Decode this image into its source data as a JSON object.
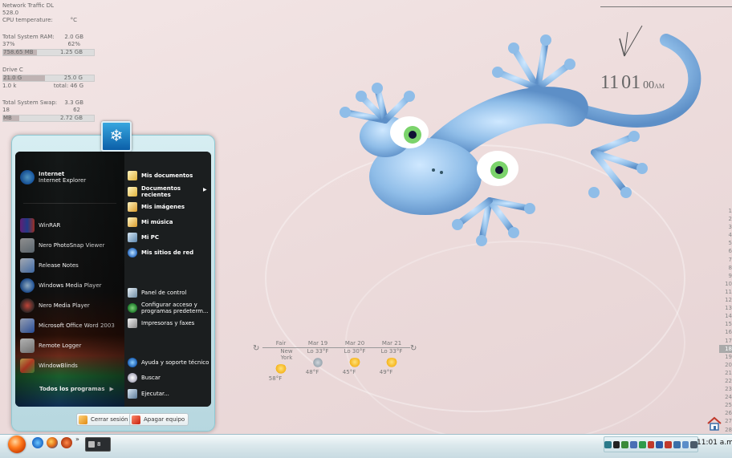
{
  "monitor": {
    "net_label": "Network Traffic DL",
    "net_value": "528.0",
    "cpu_temp": "CPU temperature:",
    "cpu_unit": "°C",
    "ram_label": "Total System RAM:",
    "ram_total": "2.0 GB",
    "ram_pct_a": "37%",
    "ram_pct_b": "62%",
    "ram_used": "758.65 MB",
    "ram_free": "1.25 GB",
    "ram_level": 0.37,
    "drive_label": "Drive C",
    "drive_used": "21.0 G",
    "drive_free": "25.0 G",
    "drive_k": "1.0 k",
    "drive_total": "total: 46 G",
    "drive_level": 0.46,
    "swap_label": "Total System Swap:",
    "swap_total": "3.3 GB",
    "swap_a": "18",
    "swap_b": "62",
    "swap_used": "MB",
    "swap_free": "2.72 GB",
    "swap_level": 0.18
  },
  "clock": {
    "hour": "11",
    "minute": "01",
    "second": "00",
    "ampm": "AM"
  },
  "days": [
    "1",
    "2",
    "3",
    "4",
    "5",
    "6",
    "7",
    "8",
    "9",
    "10",
    "11",
    "12",
    "13",
    "14",
    "15",
    "16",
    "17",
    "18",
    "19",
    "20",
    "21",
    "22",
    "23",
    "24",
    "25",
    "26",
    "27",
    "28"
  ],
  "current_day": "18",
  "weather": {
    "cols": [
      {
        "top": "Fair",
        "sub": "New York",
        "temp": "58°F"
      },
      {
        "top": "Mar 19",
        "sub": "Lo 33°F",
        "temp": "48°F"
      },
      {
        "top": "Mar 20",
        "sub": "Lo 30°F",
        "temp": "45°F"
      },
      {
        "top": "Mar 21",
        "sub": "Lo 33°F",
        "temp": "49°F"
      }
    ]
  },
  "start_menu": {
    "pinned": [
      {
        "title": "Internet",
        "subtitle": "Internet Explorer"
      }
    ],
    "recent": [
      "WinRAR",
      "Nero PhotoSnap Viewer",
      "Release Notes",
      "Windows Media Player",
      "Nero Media Player",
      "Microsoft Office Word 2003",
      "Remote Logger",
      "WindowBlinds"
    ],
    "all_programs": "Todos los programas",
    "right": {
      "documents": "Mis documentos",
      "recent_docs_1": "Documentos",
      "recent_docs_2": "recientes",
      "pictures": "Mis imágenes",
      "music": "Mi música",
      "computer": "Mi PC",
      "network": "Mis sitios de red",
      "control_panel": "Panel de control",
      "defaults_1": "Configurar acceso y",
      "defaults_2": "programas predeterm...",
      "printers": "Impresoras y faxes",
      "help": "Ayuda y soporte técnico",
      "search": "Buscar",
      "run": "Ejecutar..."
    },
    "logoff": "Cerrar sesión",
    "shutdown": "Apagar equipo"
  },
  "taskbar": {
    "task_label": "8",
    "time": "11:01 a.m."
  }
}
